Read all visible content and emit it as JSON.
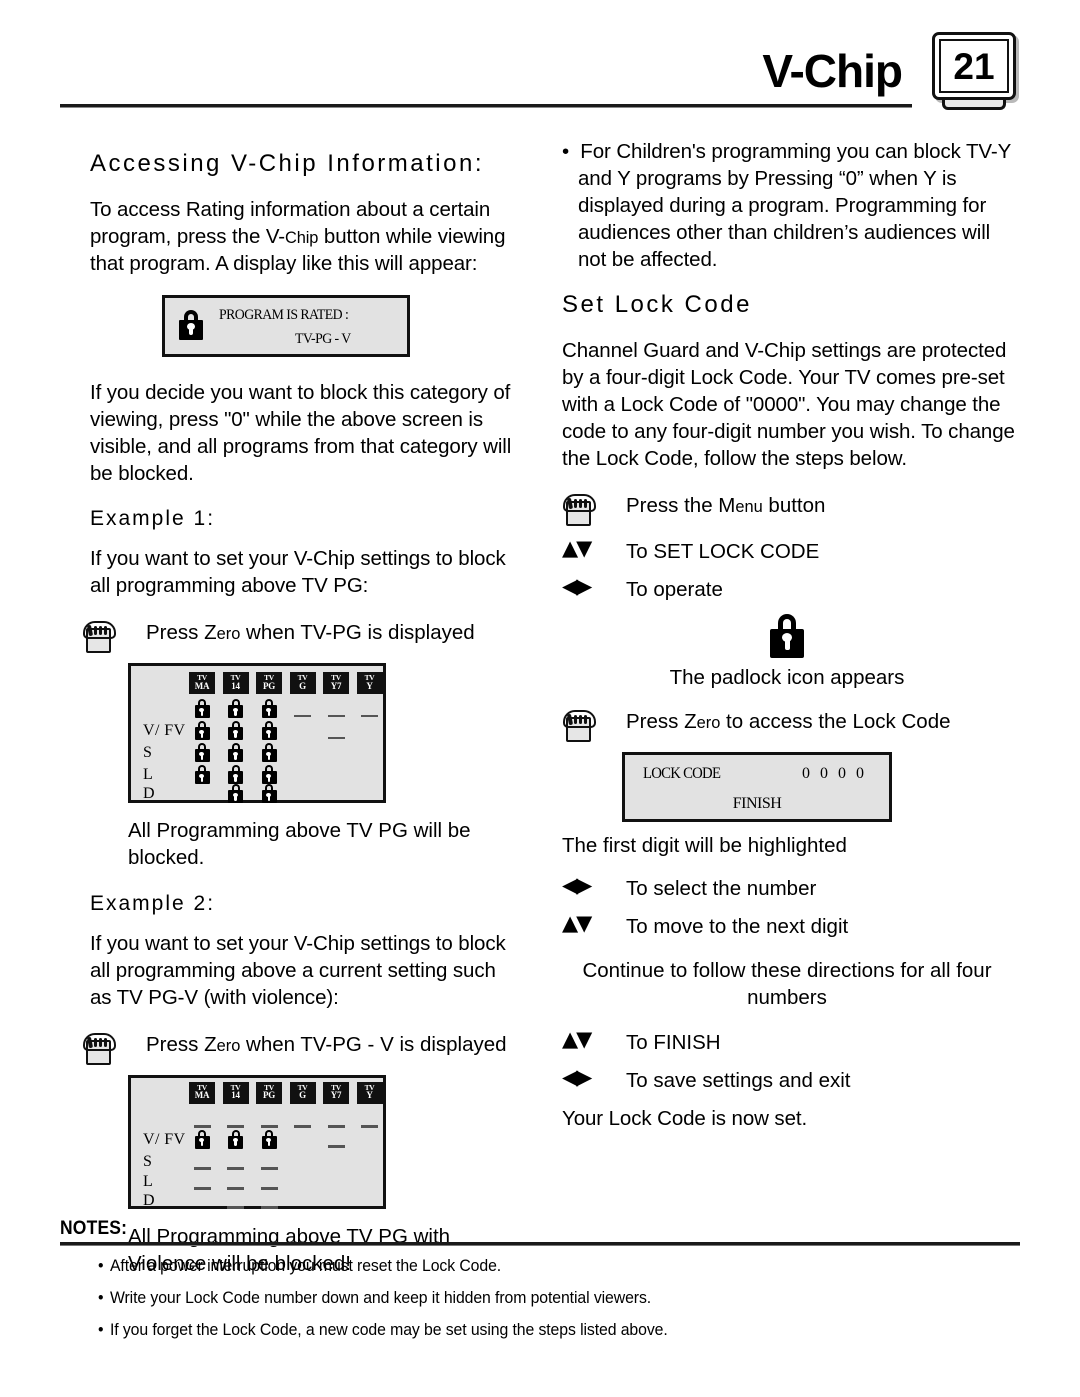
{
  "header": {
    "title": "V-Chip",
    "page_number": "21",
    "tv_badge_icon": "tv-screen-icon"
  },
  "left_column": {
    "section_title": "Accessing V-Chip Information:",
    "intro_paragraph_pre": "To access Rating information about a certain program, press the V-",
    "intro_paragraph_sc": "Chip",
    "intro_paragraph_post": " button while viewing that program. A display like this will appear:",
    "rated_osd": {
      "lock_icon": "padlock-icon",
      "line1": "PROGRAM IS RATED   :",
      "line2": "TV-PG - V"
    },
    "block_paragraph": "If you decide you want to block this category of viewing, press \"0\" while the above screen is visible, and all programs from that category will be blocked.",
    "example1": {
      "heading": "Example 1:",
      "lead": "If you want to set your V-Chip settings to block all programming above TV PG:",
      "step_icon": "hand-press-button-icon",
      "step_pre": "Press Z",
      "step_sc": "ero",
      "step_post": " when TV-PG is displayed",
      "caption": "All Programming above TV PG will be blocked."
    },
    "example2": {
      "heading": "Example 2:",
      "lead": "If you want to set your V-Chip settings to block all programming above a current setting such as TV PG-V (with violence):",
      "step_icon": "hand-press-button-icon",
      "step_pre": "Press Z",
      "step_sc": "ero",
      "step_post": " when TV-PG - V is displayed",
      "caption": "All Programming above TV PG with Violence will be blocked!"
    }
  },
  "right_column": {
    "bullet_paragraph": "For Children's programming you can block TV-Y and Y programs by Pressing “0” when Y is displayed during a program. Programming for audiences other than children’s audiences will not be affected.",
    "section_title": "Set Lock Code",
    "intro_paragraph": "Channel Guard and V-Chip settings are protected by a four-digit Lock Code. Your TV comes pre-set with a Lock Code of \"0000\". You may change the code to any four-digit number you wish. To change the Lock Code, follow the steps below.",
    "steps": [
      {
        "icon": "hand-press-button-icon",
        "pre": "Press the M",
        "sc": "enu",
        "post": " button"
      },
      {
        "icon": "up-down-arrows-icon",
        "glyph": "▲▼",
        "text": "To SET LOCK CODE"
      },
      {
        "icon": "left-right-arrows-icon",
        "glyph": "◀▶",
        "text": "To operate"
      }
    ],
    "padlock_icon": "padlock-icon",
    "padlock_caption": "The padlock icon appears",
    "zero_step": {
      "icon": "hand-press-button-icon",
      "pre": "Press Z",
      "sc": "ero",
      "post": " to access the Lock Code"
    },
    "lockcode_osd": {
      "label": "LOCK CODE",
      "value": "0 0 0 0",
      "finish": "FINISH"
    },
    "first_digit_note": "The first digit will be highlighted",
    "steps2": [
      {
        "icon": "left-right-arrows-icon",
        "glyph": "◀▶",
        "text": "To select the number"
      },
      {
        "icon": "up-down-arrows-icon",
        "glyph": "▲▼",
        "text": "To move to the next digit"
      }
    ],
    "continue_note": "Continue to follow these directions for all four numbers",
    "steps3": [
      {
        "icon": "up-down-arrows-icon",
        "glyph": "▲▼",
        "text": "To FINISH"
      },
      {
        "icon": "left-right-arrows-icon",
        "glyph": "◀▶",
        "text": "To save settings and exit"
      }
    ],
    "closing": "Your Lock Code is now set."
  },
  "notes": {
    "title": "NOTES:",
    "bullet": "•",
    "items": [
      "After a power interruption you must reset the Lock Code.",
      "Write your Lock Code number down and keep it hidden from potential viewers.",
      "If you forget the Lock Code, a new code may be set using the steps listed above."
    ]
  },
  "rating_grid": {
    "columns": [
      {
        "top": "TV",
        "bottom": "MA"
      },
      {
        "top": "TV",
        "bottom": "14"
      },
      {
        "top": "TV",
        "bottom": "PG"
      },
      {
        "top": "TV",
        "bottom": "G"
      },
      {
        "top": "TV",
        "bottom": "Y7"
      },
      {
        "top": "TV",
        "bottom": "Y"
      }
    ],
    "row_labels": [
      "",
      "V/ FV",
      "S",
      "L",
      "D"
    ],
    "grid1": [
      [
        "lock",
        "lock",
        "lock",
        "dash",
        "dash",
        "dash"
      ],
      [
        "lock",
        "lock",
        "lock",
        "",
        "dash",
        ""
      ],
      [
        "lock",
        "lock",
        "lock",
        "",
        "",
        ""
      ],
      [
        "lock",
        "lock",
        "lock",
        "",
        "",
        ""
      ],
      [
        "",
        "lock",
        "lock",
        "",
        "",
        ""
      ]
    ],
    "grid2": [
      [
        "dash",
        "dash",
        "dash",
        "dash",
        "dash",
        "dash"
      ],
      [
        "lock",
        "lock",
        "lock",
        "",
        "dash",
        ""
      ],
      [
        "dash",
        "dash",
        "dash",
        "",
        "",
        ""
      ],
      [
        "dash",
        "dash",
        "dash",
        "",
        "",
        ""
      ],
      [
        "",
        "dash",
        "dash",
        "",
        "",
        ""
      ]
    ]
  }
}
